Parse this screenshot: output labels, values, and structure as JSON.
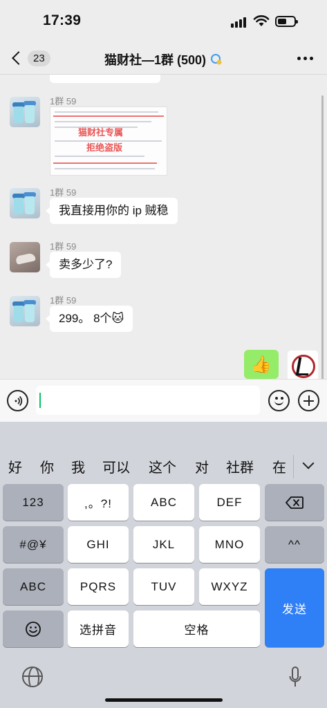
{
  "status_bar": {
    "time": "17:39"
  },
  "header": {
    "back_badge": "23",
    "title": "猫财社—1群 (500)"
  },
  "messages": [
    {
      "sender": "1群 59",
      "kind": "image",
      "watermark_line1": "猫财社专属",
      "watermark_line2": "拒绝盗版"
    },
    {
      "sender": "1群 59",
      "kind": "text",
      "text": "我直接用你的 ip 贼稳"
    },
    {
      "sender": "1群 59",
      "kind": "text",
      "text": "卖多少了?"
    },
    {
      "sender": "1群 59",
      "kind": "text",
      "text": "299。 8个🐱"
    }
  ],
  "my_message": {
    "text": "👍"
  },
  "candidates": [
    "好",
    "你",
    "我",
    "可以",
    "这个",
    "对",
    "社群",
    "在"
  ],
  "keyboard": {
    "row1": [
      "123",
      ",。?!",
      "ABC",
      "DEF"
    ],
    "row2": [
      "#@¥",
      "GHI",
      "JKL",
      "MNO",
      "^^"
    ],
    "row3": [
      "ABC",
      "PQRS",
      "TUV",
      "WXYZ"
    ],
    "row4": [
      "选拼音",
      "空格"
    ],
    "send": "发送"
  }
}
